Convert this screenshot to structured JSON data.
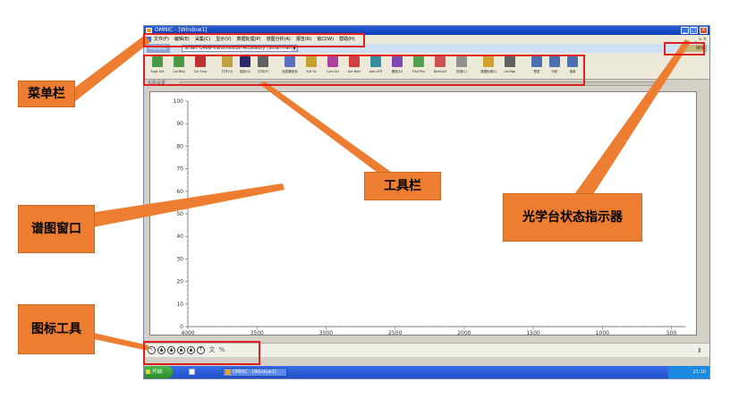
{
  "window": {
    "title": "OMNIC - [Window1]"
  },
  "menu": {
    "items": [
      "文件(F)",
      "编辑(E)",
      "采集(C)",
      "显示(V)",
      "数据处理(P)",
      "谱图分析(A)",
      "报告(R)",
      "窗口(W)",
      "帮助(H)"
    ],
    "mdi_controls": "_ ▫ ×"
  },
  "accessory": {
    "label": "实验设置:",
    "selected": "Smart OMNI-Transmission Accessory  (SmartTransB"
  },
  "bench_status": {
    "text": "就绪",
    "color": "#2a9a2a"
  },
  "toolbar": {
    "tools": [
      {
        "label": "Expt Set",
        "icon": "expt-set-icon",
        "color": "#4a9a4a"
      },
      {
        "label": "Col Bkg",
        "icon": "collect-background-icon",
        "color": "#4a9a4a"
      },
      {
        "label": "Col Smp",
        "icon": "collect-sample-icon",
        "color": "#c03030"
      },
      {
        "label": "打开(O)",
        "icon": "open-icon",
        "color": "#c0a040"
      },
      {
        "label": "保存(S)",
        "icon": "save-icon",
        "color": "#2a2a6a"
      },
      {
        "label": "打印(P)",
        "icon": "print-icon",
        "color": "#606060"
      },
      {
        "label": "全显横坐标",
        "icon": "full-scale-icon",
        "color": "#5a70c0"
      },
      {
        "label": "Full Sc",
        "icon": "full-scale-y-icon",
        "color": "#c8a030"
      },
      {
        "label": "Com Scl",
        "icon": "common-scale-icon",
        "color": "#b040a0"
      },
      {
        "label": "Aut Bsln",
        "icon": "auto-baseline-icon",
        "color": "#d04040"
      },
      {
        "label": "Add ATR",
        "icon": "advanced-atr-icon",
        "color": "#3a8aa0"
      },
      {
        "label": "基准(D)",
        "icon": "baseline-icon",
        "color": "#7a4ab0"
      },
      {
        "label": "Find Pks",
        "icon": "find-peaks-icon",
        "color": "#50a050"
      },
      {
        "label": "Delet All",
        "icon": "delete-all-icon",
        "color": "#d05050"
      },
      {
        "label": "检测(L)",
        "icon": "inspect-icon",
        "color": "#909090"
      },
      {
        "label": "谱图检索(I)",
        "icon": "spectral-search-icon",
        "color": "#d0a030"
      },
      {
        "label": "Lib Mgr",
        "icon": "library-manager-icon",
        "color": "#606060"
      },
      {
        "label": "预览",
        "icon": "preview-icon",
        "color": "#4a70b0"
      },
      {
        "label": "分析",
        "icon": "analysis-icon",
        "color": "#4a70b0"
      },
      {
        "label": "谱库",
        "icon": "library-icon",
        "color": "#4a70b0"
      }
    ]
  },
  "strip": {
    "label": "实验设置"
  },
  "icon_tools": {
    "items": [
      {
        "glyph": "↖",
        "icon": "selection-tool-icon"
      },
      {
        "glyph": "▲",
        "icon": "region-tool-icon"
      },
      {
        "glyph": "▲",
        "icon": "peak-height-tool-icon"
      },
      {
        "glyph": "▲",
        "icon": "peak-area-tool-icon"
      },
      {
        "glyph": "▲",
        "icon": "annotation-tool-icon"
      },
      {
        "glyph": "T",
        "icon": "text-tool-icon"
      },
      {
        "glyph": "文",
        "icon": "chinese-text-icon"
      },
      {
        "glyph": "%",
        "icon": "percent-tool-icon"
      }
    ]
  },
  "taskbar": {
    "start": "开始",
    "task": "OMNIC - [Window1]",
    "clock": "21:10"
  },
  "chart_data": {
    "type": "line",
    "x": [],
    "series": [],
    "xlim": [
      4000,
      400
    ],
    "ylim": [
      0,
      100
    ],
    "xticks": [
      4000,
      3500,
      3000,
      2500,
      2000,
      1500,
      1000,
      500
    ],
    "yticks": [
      0,
      10,
      20,
      30,
      40,
      50,
      60,
      70,
      80,
      90,
      100
    ],
    "grid": false,
    "xlabel": "",
    "ylabel": ""
  },
  "annotations": {
    "menubar": "菜单栏",
    "toolbar": "工具栏",
    "spectrum_window": "谱图窗口",
    "bench_indicator": "光学台状态指示器",
    "icon_tools": "图标工具"
  }
}
